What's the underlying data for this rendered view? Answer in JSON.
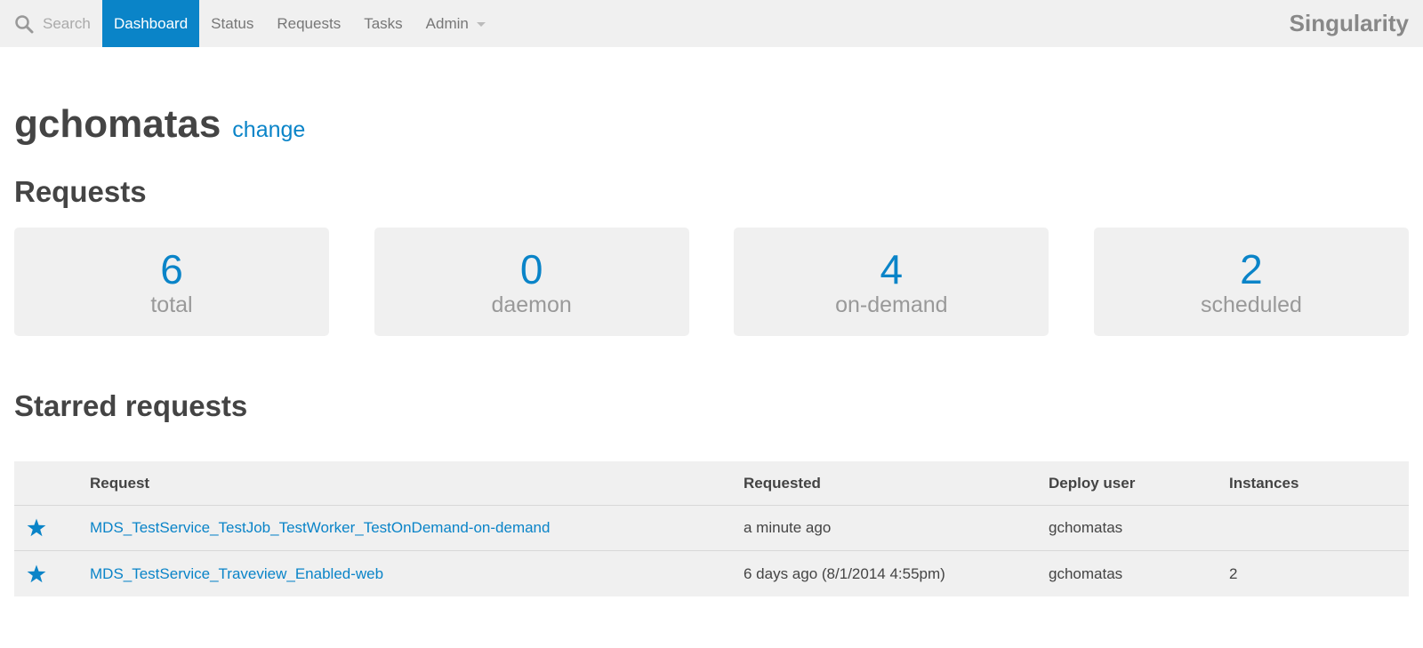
{
  "navbar": {
    "search_placeholder": "Search",
    "items": [
      {
        "label": "Dashboard",
        "active": true
      },
      {
        "label": "Status"
      },
      {
        "label": "Requests"
      },
      {
        "label": "Tasks"
      },
      {
        "label": "Admin"
      }
    ],
    "brand": "Singularity"
  },
  "user": {
    "name": "gchomatas",
    "change_label": "change"
  },
  "requests": {
    "title": "Requests",
    "stats": [
      {
        "value": "6",
        "label": "total"
      },
      {
        "value": "0",
        "label": "daemon"
      },
      {
        "value": "4",
        "label": "on-demand"
      },
      {
        "value": "2",
        "label": "scheduled"
      }
    ]
  },
  "starred": {
    "title": "Starred requests",
    "columns": {
      "request": "Request",
      "requested": "Requested",
      "deploy_user": "Deploy user",
      "instances": "Instances"
    },
    "rows": [
      {
        "request": "MDS_TestService_TestJob_TestWorker_TestOnDemand-on-demand",
        "requested": "a minute ago",
        "deploy_user": "gchomatas",
        "instances": ""
      },
      {
        "request": "MDS_TestService_Traveview_Enabled-web",
        "requested": "6 days ago (8/1/2014 4:55pm)",
        "deploy_user": "gchomatas",
        "instances": "2"
      }
    ]
  },
  "colors": {
    "accent": "#0a84c8",
    "panel": "#f0f0f0",
    "muted": "#999999"
  },
  "icons": [
    "search-icon",
    "star-icon",
    "chevron-down-icon"
  ]
}
